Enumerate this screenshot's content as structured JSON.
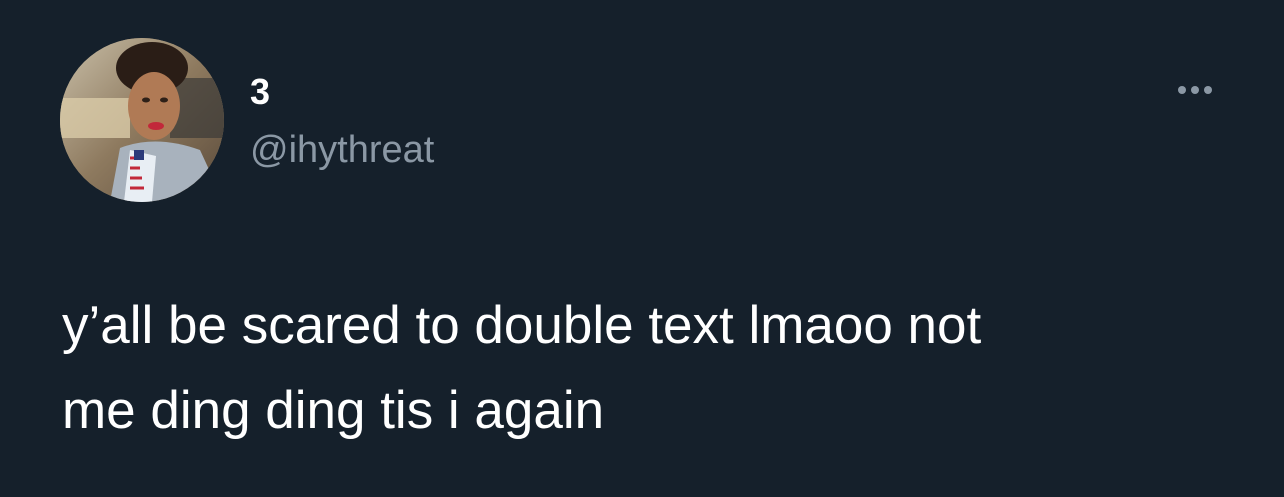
{
  "tweet": {
    "author": {
      "display_name": "3",
      "handle": "@ihythreat",
      "avatar_icon": "profile-photo"
    },
    "more_icon": "more-options-icon",
    "text": "y’all be scared to double text lmaoo not\nme ding ding tis i again"
  },
  "colors": {
    "background": "#15202b",
    "name": "#ffffff",
    "handle": "#8b98a5",
    "text": "#ffffff"
  }
}
